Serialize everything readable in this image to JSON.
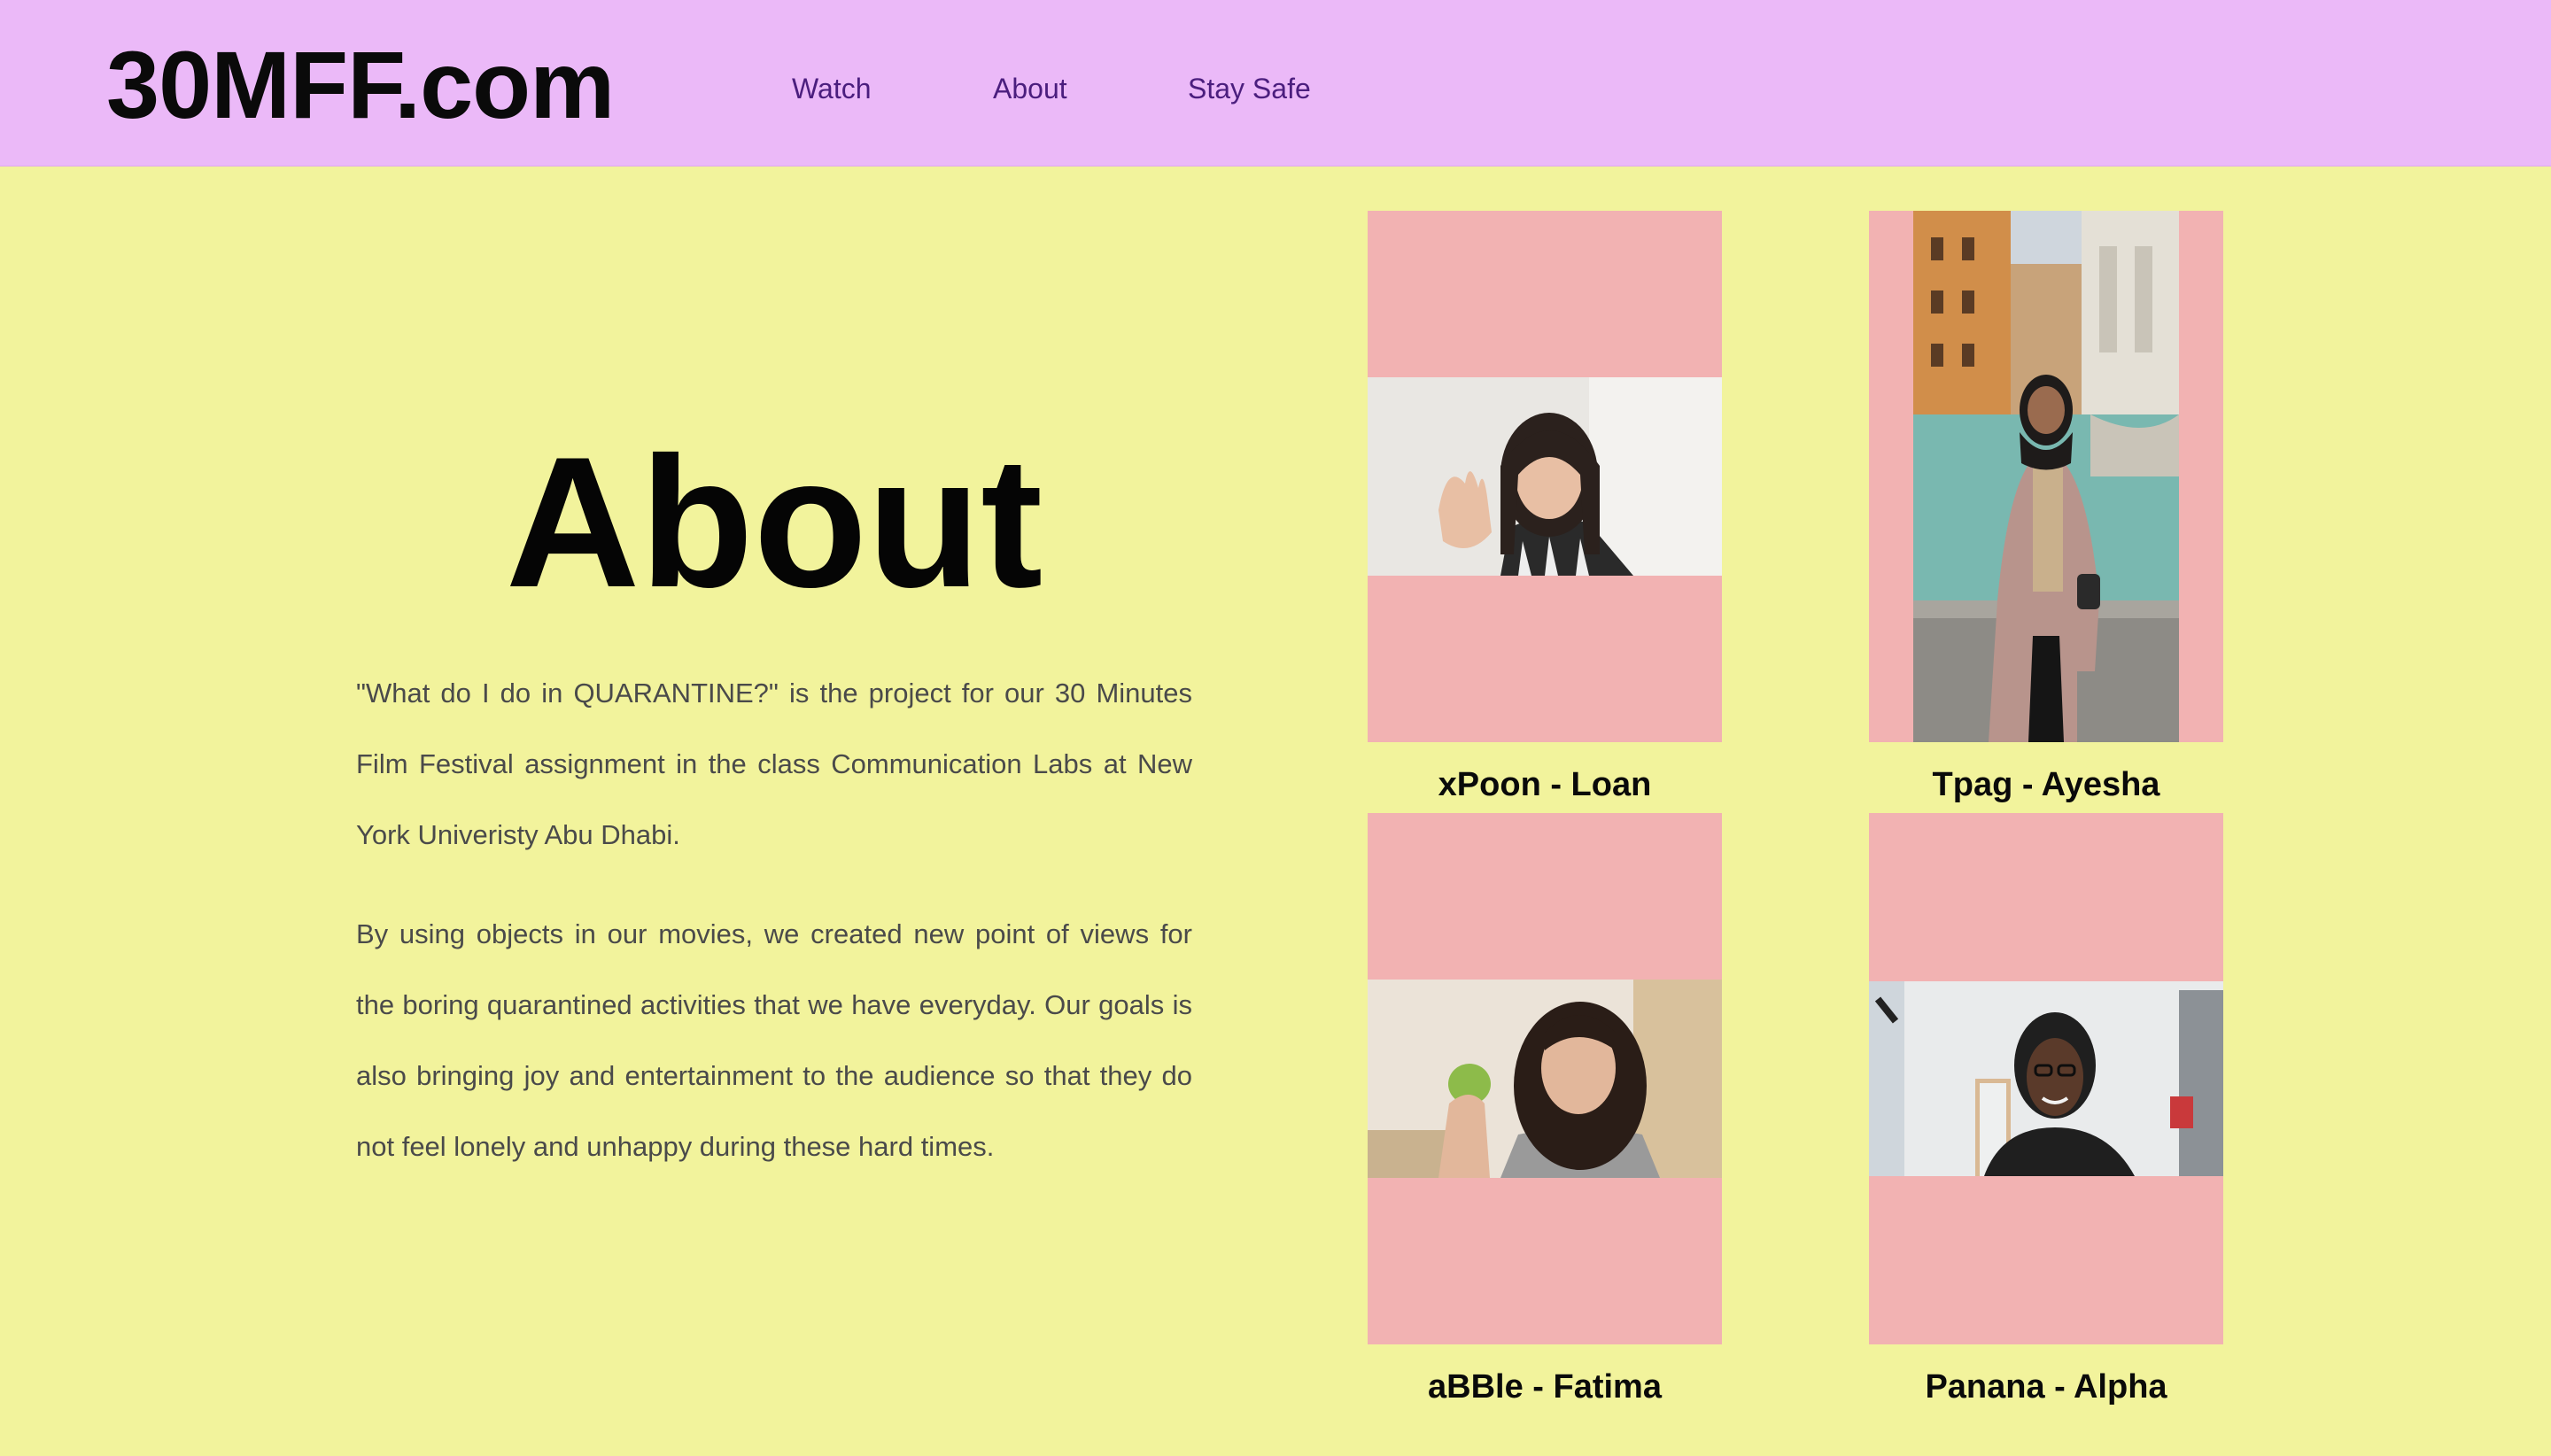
{
  "header": {
    "logo": "30MFF.com",
    "nav": [
      {
        "label": "Watch"
      },
      {
        "label": "About"
      },
      {
        "label": "Stay Safe"
      }
    ]
  },
  "main": {
    "heading": "About",
    "paragraphs": [
      "\"What do I do in QUARANTINE?\" is the project for our 30 Minutes Film Festival assignment in the class Communication Labs at New York Univeristy Abu Dhabi.",
      "By using objects in our movies, we created new point of views for the boring quarantined activities that we have everyday. Our goals is also bringing joy and entertainment to the audience so that they do not feel lonely and unhappy during these hard times."
    ]
  },
  "team": [
    {
      "name": "xPoon - Loan"
    },
    {
      "name": "Tpag - Ayesha"
    },
    {
      "name": "aBBle - Fatima"
    },
    {
      "name": "Panana - Alpha"
    }
  ],
  "colors": {
    "header_bg": "#ebb9f8",
    "page_bg": "#f2f39c",
    "card_bg": "#f2b2b2",
    "nav_text": "#4b1e7e"
  }
}
